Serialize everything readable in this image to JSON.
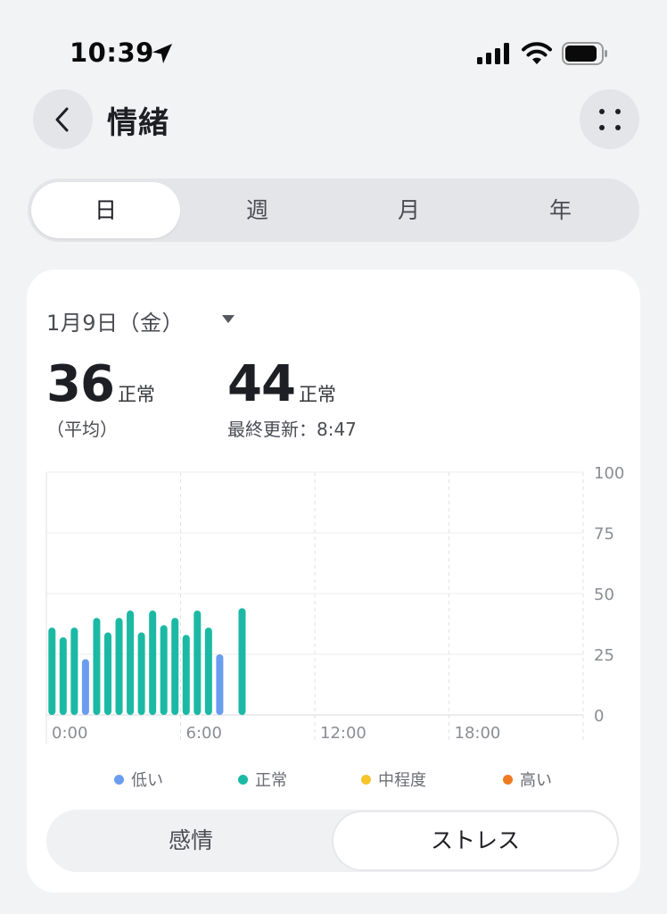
{
  "status_bar": {
    "time": "10:39",
    "icons": [
      "location-arrow-icon",
      "signal-bars-icon",
      "wifi-icon",
      "battery-icon"
    ]
  },
  "header": {
    "title": "情緒",
    "back_icon": "chevron-left-icon",
    "more_icon": "four-dots-icon"
  },
  "period_tabs": [
    {
      "label": "日",
      "active": true
    },
    {
      "label": "週",
      "active": false
    },
    {
      "label": "月",
      "active": false
    },
    {
      "label": "年",
      "active": false
    }
  ],
  "card": {
    "date": "1月9日（金）",
    "average": {
      "value": "36",
      "level": "正常",
      "label": "（平均）"
    },
    "latest": {
      "value": "44",
      "level": "正常",
      "label": "最終更新：8:47"
    }
  },
  "legend": [
    {
      "label": "低い",
      "color": "#6A9DF0"
    },
    {
      "label": "正常",
      "color": "#1BB9A4"
    },
    {
      "label": "中程度",
      "color": "#F6C52B"
    },
    {
      "label": "高い",
      "color": "#F07A22"
    }
  ],
  "mode_toggle": [
    {
      "label": "感情",
      "active": false
    },
    {
      "label": "ストレス",
      "active": true
    }
  ],
  "chart_data": {
    "type": "bar",
    "x_unit": "hour",
    "xlim": [
      0,
      24
    ],
    "ylim": [
      0,
      100
    ],
    "x_ticks": [
      {
        "value": 0,
        "label": "0:00"
      },
      {
        "value": 6,
        "label": "6:00"
      },
      {
        "value": 12,
        "label": "12:00"
      },
      {
        "value": 18,
        "label": "18:00"
      }
    ],
    "y_ticks": [
      0,
      25,
      50,
      75,
      100
    ],
    "y_axis_side": "right",
    "grid": true,
    "series": [
      {
        "name": "正常",
        "color": "#1BB9A4",
        "points": [
          {
            "x": 0.25,
            "y": 36
          },
          {
            "x": 0.75,
            "y": 32
          },
          {
            "x": 1.25,
            "y": 36
          },
          {
            "x": 2.25,
            "y": 40
          },
          {
            "x": 2.75,
            "y": 34
          },
          {
            "x": 3.25,
            "y": 40
          },
          {
            "x": 3.75,
            "y": 43
          },
          {
            "x": 4.25,
            "y": 34
          },
          {
            "x": 4.75,
            "y": 43
          },
          {
            "x": 5.25,
            "y": 37
          },
          {
            "x": 5.75,
            "y": 40
          },
          {
            "x": 6.25,
            "y": 33
          },
          {
            "x": 6.75,
            "y": 43
          },
          {
            "x": 7.25,
            "y": 36
          },
          {
            "x": 8.75,
            "y": 44
          }
        ]
      },
      {
        "name": "低い",
        "color": "#6A9DF0",
        "points": [
          {
            "x": 1.75,
            "y": 23
          },
          {
            "x": 7.75,
            "y": 25
          }
        ]
      }
    ]
  }
}
